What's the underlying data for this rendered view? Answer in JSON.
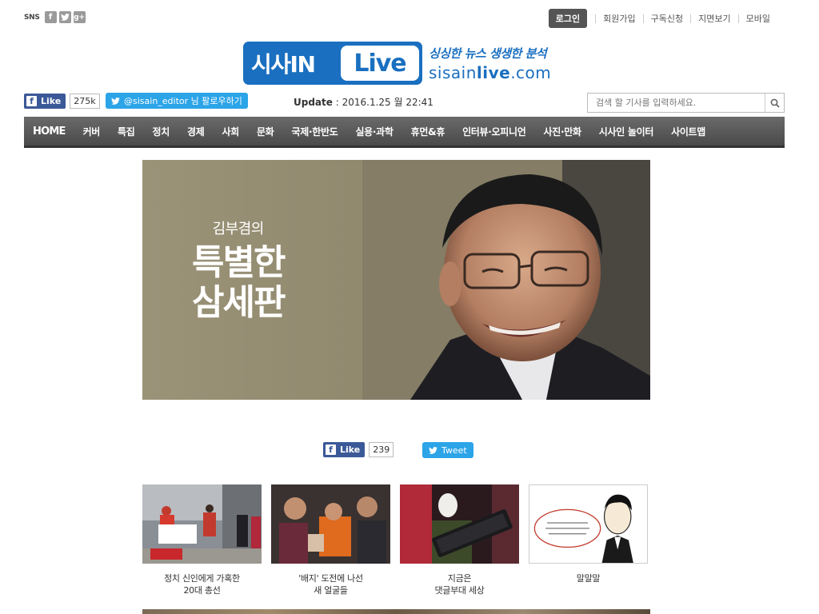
{
  "topbar": {
    "sns_label": "SNS",
    "sns_icons": [
      "facebook-icon",
      "twitter-icon",
      "googleplus-icon"
    ],
    "login": "로그인",
    "links": [
      "회원가입",
      "구독신청",
      "지면보기",
      "모바일"
    ]
  },
  "logo": {
    "sisa": "시사IN",
    "live": "Live",
    "slogan": "싱싱한 뉴스 생생한 분석",
    "url_prefix": "sisain",
    "url_bold": "live",
    "url_suffix": ".com"
  },
  "social": {
    "fb_like_label": "Like",
    "fb_like_count": "275k",
    "twitter_follow": "@sisain_editor 님 팔로우하기"
  },
  "update": {
    "label": "Update",
    "value": ": 2016.1.25 월 22:41"
  },
  "search": {
    "placeholder": "검색 할 기사를 입력하세요."
  },
  "nav": [
    "HOME",
    "커버",
    "특집",
    "정치",
    "경제",
    "사회",
    "문화",
    "국제·한반도",
    "실용·과학",
    "휴먼&휴",
    "인터뷰·오피니언",
    "사진·만화",
    "시사인 놀이터",
    "사이트맵"
  ],
  "hero": {
    "sub": "김부겸의",
    "main_line1": "특별한",
    "main_line2": "삼세판"
  },
  "share": {
    "fb_like_label": "Like",
    "fb_like_count": "239",
    "tweet_label": "Tweet"
  },
  "thumbs": [
    {
      "line1": "정치 신인에게 가혹한",
      "line2": "20대 총선"
    },
    {
      "line1": "'배지' 도전에 나선",
      "line2": "새 얼굴들"
    },
    {
      "line1": "지금은",
      "line2": "댓글부대 세상"
    },
    {
      "line1": "말말말",
      "line2": ""
    }
  ],
  "colors": {
    "brand_blue": "#1a6fc0",
    "facebook": "#3b5998",
    "twitter": "#2ba4e8",
    "nav_bg": "#555555"
  }
}
